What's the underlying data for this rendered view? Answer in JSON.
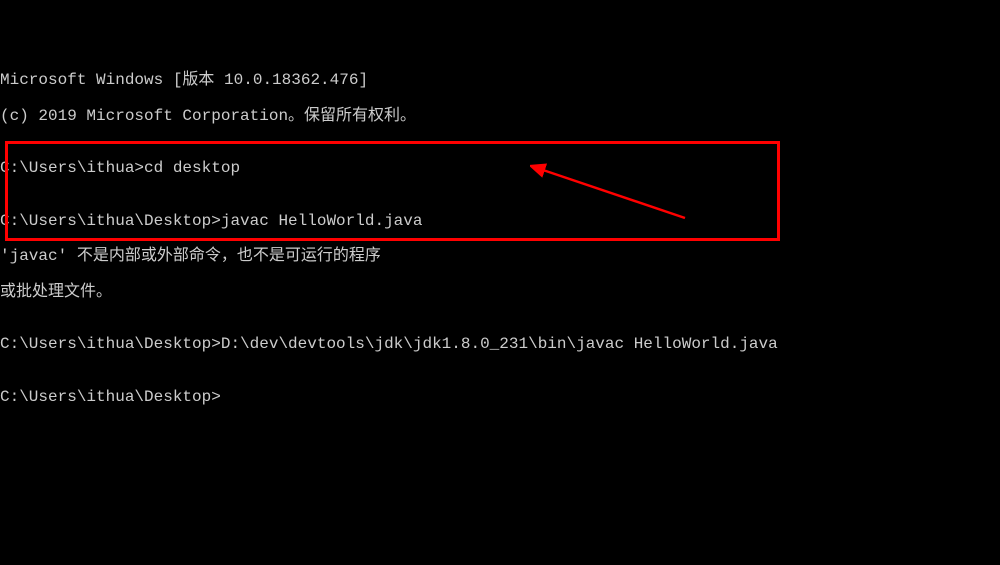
{
  "lines": {
    "l0": "Microsoft Windows [版本 10.0.18362.476]",
    "l1": "(c) 2019 Microsoft Corporation。保留所有权利。",
    "l2": "",
    "l3": "C:\\Users\\ithua>cd desktop",
    "l4": "",
    "l5": "C:\\Users\\ithua\\Desktop>javac HelloWorld.java",
    "l6": "'javac' 不是内部或外部命令，也不是可运行的程序",
    "l7": "或批处理文件。",
    "l8": "",
    "l9": "C:\\Users\\ithua\\Desktop>D:\\dev\\devtools\\jdk\\jdk1.8.0_231\\bin\\javac HelloWorld.java",
    "l10": "",
    "l11": "C:\\Users\\ithua\\Desktop>"
  },
  "annotation": {
    "box_color": "#ff0000",
    "arrow_color": "#ff0000"
  }
}
